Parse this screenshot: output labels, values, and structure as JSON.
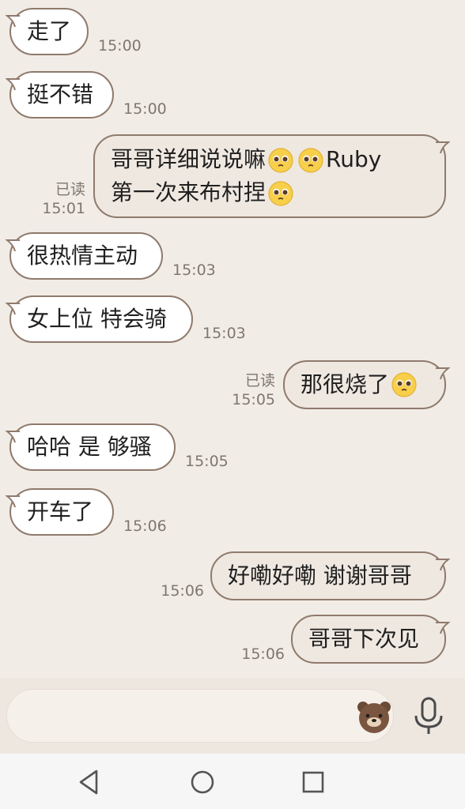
{
  "messages": [
    {
      "dir": "in",
      "text": "走了",
      "time": "15:00"
    },
    {
      "dir": "in",
      "text": "挺不错",
      "time": "15:00"
    },
    {
      "dir": "out",
      "lines": [
        "哥哥详细说说嘛",
        "Ruby",
        "第一次来布村捏"
      ],
      "read": "已读",
      "time": "15:01"
    },
    {
      "dir": "in",
      "text": "很热情主动",
      "time": "15:03"
    },
    {
      "dir": "in",
      "text": "女上位 特会骑",
      "time": "15:03"
    },
    {
      "dir": "out",
      "text": "那很烧了",
      "read": "已读",
      "time": "15:05"
    },
    {
      "dir": "in",
      "text": "哈哈 是 够骚",
      "time": "15:05"
    },
    {
      "dir": "in",
      "text": "开车了",
      "time": "15:06"
    },
    {
      "dir": "out",
      "text": "好嘞好嘞 谢谢哥哥",
      "time": "15:06"
    },
    {
      "dir": "out",
      "text": "哥哥下次见",
      "time": "15:06"
    }
  ],
  "composer": {
    "sticker_icon": "bear-sticker-icon",
    "mic_icon": "microphone-icon"
  },
  "navbar": {
    "back_icon": "triangle-back-icon",
    "home_icon": "circle-home-icon",
    "recents_icon": "square-recents-icon"
  },
  "colors": {
    "background": "#f1ece6",
    "bubble_border": "#8f7a6c",
    "sent_bubble": "#efe8e1",
    "received_bubble": "#ffffff",
    "timestamp": "#7d7770"
  }
}
